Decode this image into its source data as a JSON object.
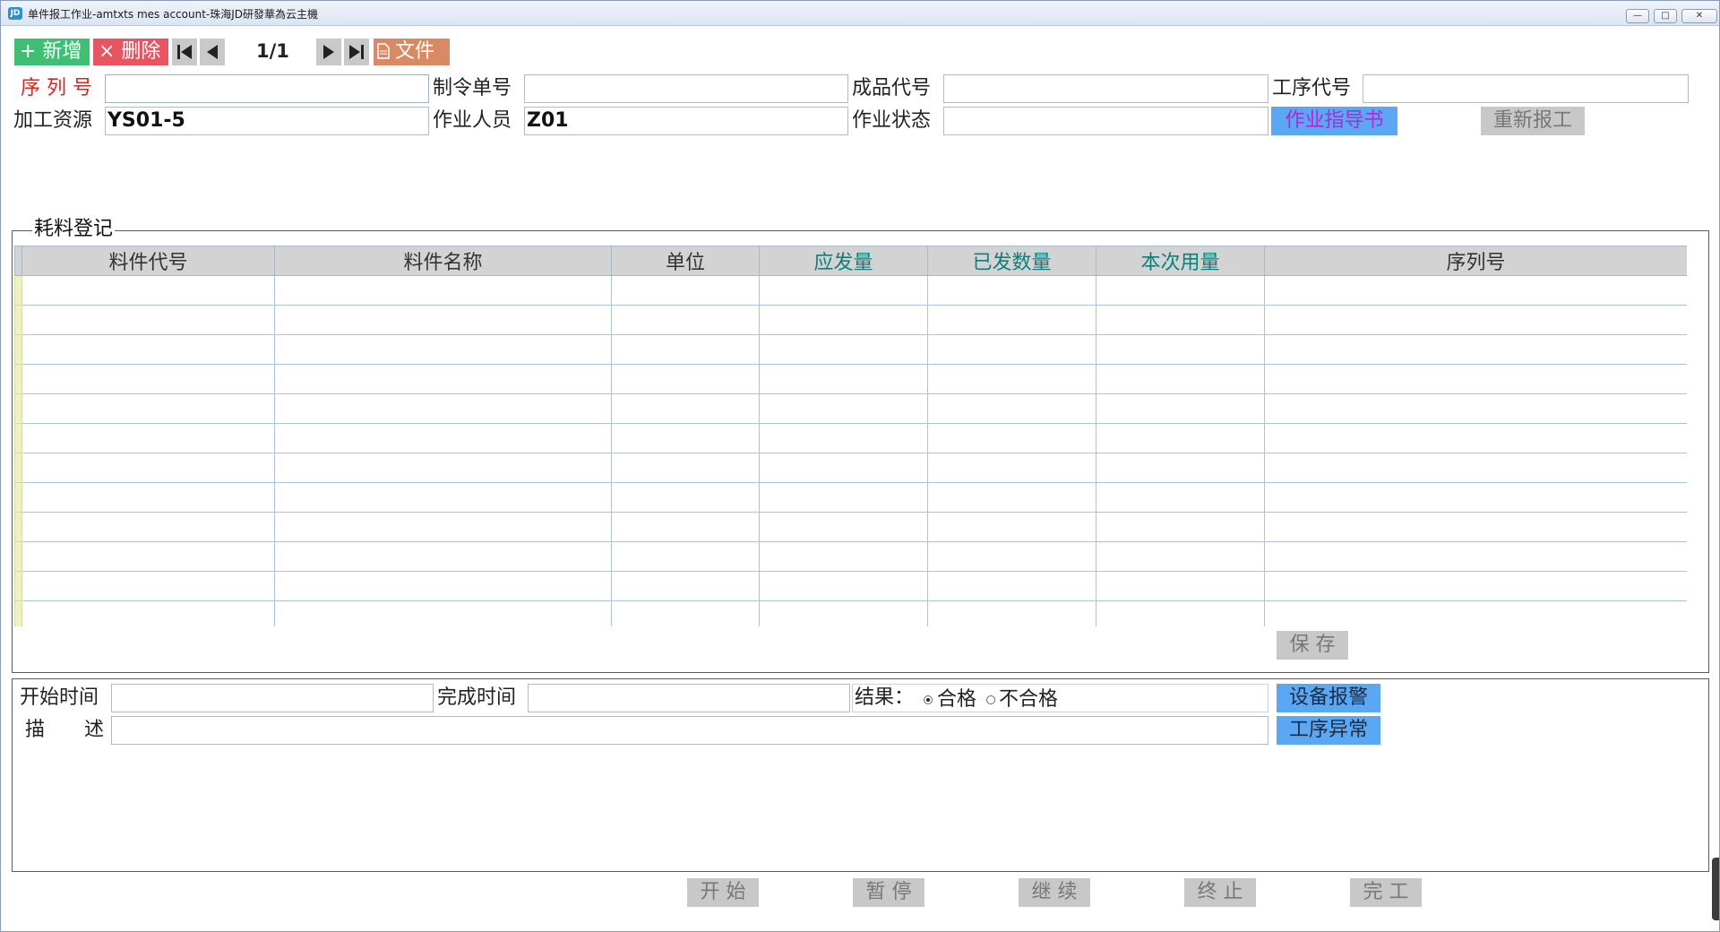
{
  "window": {
    "app_icon": "JD",
    "title": "单件报工作业-amtxts mes account-珠海JD研發華為云主機",
    "controls": {
      "minimize": "—",
      "maximize": "□",
      "close": "✕"
    }
  },
  "toolbar": {
    "add_label": "+ 新增",
    "delete_label": "× 删除",
    "file_label": "文件",
    "pager": "1/1",
    "colors": {
      "add": "#3fbf73",
      "delete": "#e8545f",
      "file": "#d98a63"
    }
  },
  "form": {
    "serial_label": "序 列 号",
    "serial_value": "",
    "order_label": "制令单号",
    "order_value": "",
    "product_label": "成品代号",
    "product_value": "",
    "process_label": "工序代号",
    "process_value": "",
    "resource_label": "加工资源",
    "resource_value": "YS01-5",
    "operator_label": "作业人员",
    "operator_value": "Z01",
    "status_label": "作业状态",
    "status_value": "",
    "guide_button": "作业指导书",
    "rereport_button": "重新报工"
  },
  "material": {
    "group_title": "耗料登记",
    "columns": [
      "料件代号",
      "料件名称",
      "单位",
      "应发量",
      "已发数量",
      "本次用量",
      "序列号"
    ],
    "row_count": 12,
    "save_button": "保 存"
  },
  "report": {
    "start_label": "开始时间",
    "start_value": "",
    "finish_label": "完成时间",
    "finish_value": "",
    "result_label": "结果：",
    "result_pass": "合格",
    "result_fail": "不合格",
    "result_selected": "合格",
    "desc_label": "描　　述",
    "desc_value": "",
    "alarm_button": "设备报警",
    "abnormal_button": "工序异常"
  },
  "actions": {
    "start": "开 始",
    "pause": "暂 停",
    "resume": "继 续",
    "stop": "终 止",
    "complete": "完 工"
  }
}
